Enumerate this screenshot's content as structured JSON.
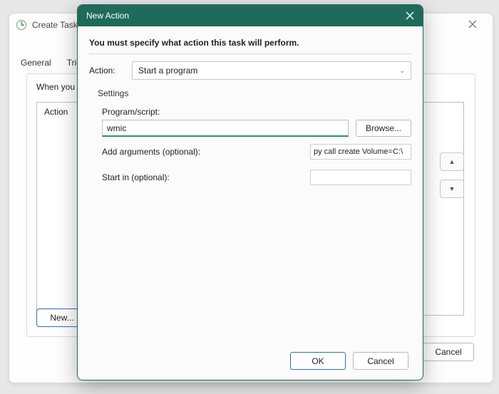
{
  "bg": {
    "title": "Create Task",
    "tabs": [
      "General",
      "Triq"
    ],
    "when_label": "When you c",
    "list_header": "Action",
    "new_button": "New...",
    "cancel_button": "Cancel",
    "spin_up": "▲",
    "spin_down": "▼"
  },
  "dialog": {
    "title": "New Action",
    "instruction": "You must specify what action this task will perform.",
    "action_label": "Action:",
    "action_value": "Start a program",
    "settings_label": "Settings",
    "program_label": "Program/script:",
    "program_value": "wmic",
    "browse_label": "Browse...",
    "args_label": "Add arguments (optional):",
    "args_value": "py call create Volume=C:\\",
    "startin_label": "Start in (optional):",
    "startin_value": "",
    "ok_label": "OK",
    "cancel_label": "Cancel"
  }
}
